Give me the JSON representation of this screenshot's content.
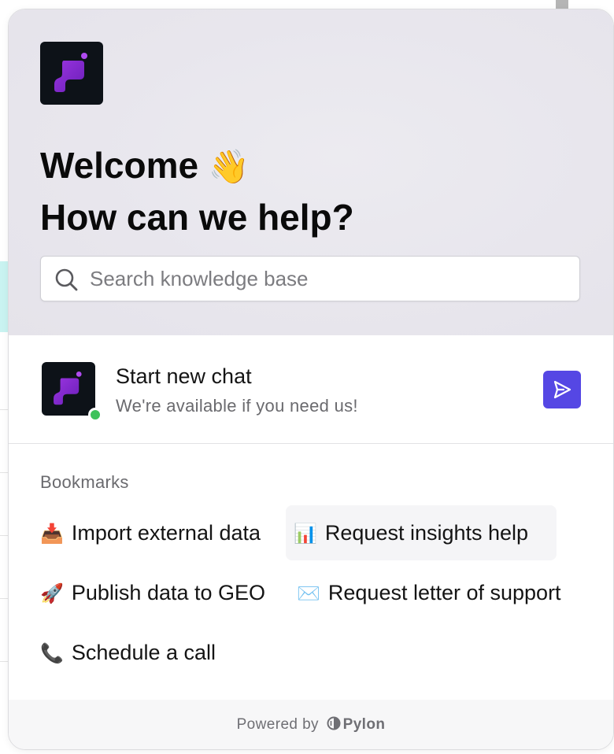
{
  "hero": {
    "welcome_line1": "Welcome",
    "wave_emoji": "👋",
    "welcome_line2": "How can we help?",
    "search_placeholder": "Search knowledge base"
  },
  "chat": {
    "title": "Start new chat",
    "subtitle": "We're available if you need us!",
    "status": "online",
    "send_icon": "send-icon"
  },
  "bookmarks": {
    "label": "Bookmarks",
    "items": [
      {
        "emoji": "📥",
        "label": "Import external data"
      },
      {
        "emoji": "📊",
        "label": "Request insights help"
      },
      {
        "emoji": "🚀",
        "label": "Publish data to GEO"
      },
      {
        "emoji": "✉️",
        "label": "Request letter of support"
      },
      {
        "emoji": "📞",
        "label": "Schedule a call"
      }
    ]
  },
  "footer": {
    "powered_by": "Powered by",
    "brand": "Pylon"
  },
  "colors": {
    "accent": "#5547e4",
    "logo_bg": "#0d1218",
    "logo_purple": "#8a2bd6",
    "status_green": "#3ec25b"
  }
}
